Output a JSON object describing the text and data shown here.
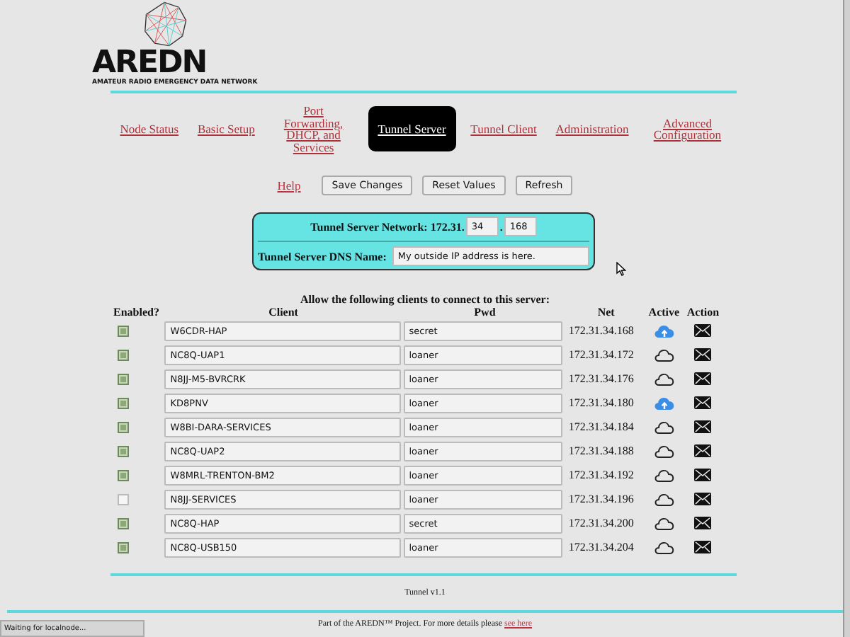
{
  "logo": {
    "wordmark": "AREDN",
    "tagline": "AMATEUR RADIO EMERGENCY DATA NETWORK"
  },
  "nav": [
    {
      "label": "Node Status",
      "selected": false
    },
    {
      "label": "Basic Setup",
      "selected": false
    },
    {
      "label": "Port Forwarding, DHCP, and Services",
      "selected": false
    },
    {
      "label": "Tunnel Server",
      "selected": true
    },
    {
      "label": "Tunnel Client",
      "selected": false
    },
    {
      "label": "Administration",
      "selected": false
    },
    {
      "label": "Advanced Configuration",
      "selected": false
    }
  ],
  "help_link": "Help",
  "buttons": [
    "Save Changes",
    "Reset Values",
    "Refresh"
  ],
  "server": {
    "network_label": "Tunnel Server Network: 172.31.",
    "octet_3": "34",
    "separator": ".",
    "octet_4": "168",
    "dns_label": "Tunnel Server DNS Name:",
    "dns_value": "My outside IP address is here."
  },
  "table": {
    "caption": "Allow the following clients to connect to this server:",
    "columns": [
      "Enabled?",
      "Client",
      "Pwd",
      "Net",
      "Active",
      "Action"
    ],
    "rows": [
      {
        "enabled": true,
        "client": "W6CDR-HAP",
        "pwd": "secret",
        "net": "172.31.34.168",
        "active": true
      },
      {
        "enabled": true,
        "client": "NC8Q-UAP1",
        "pwd": "loaner",
        "net": "172.31.34.172",
        "active": false
      },
      {
        "enabled": true,
        "client": "N8JJ-M5-BVRCRK",
        "pwd": "loaner",
        "net": "172.31.34.176",
        "active": false
      },
      {
        "enabled": true,
        "client": "KD8PNV",
        "pwd": "loaner",
        "net": "172.31.34.180",
        "active": true
      },
      {
        "enabled": true,
        "client": "W8BI-DARA-SERVICES",
        "pwd": "loaner",
        "net": "172.31.34.184",
        "active": false
      },
      {
        "enabled": true,
        "client": "NC8Q-UAP2",
        "pwd": "loaner",
        "net": "172.31.34.188",
        "active": false
      },
      {
        "enabled": true,
        "client": "W8MRL-TRENTON-BM2",
        "pwd": "loaner",
        "net": "172.31.34.192",
        "active": false
      },
      {
        "enabled": false,
        "client": "N8JJ-SERVICES",
        "pwd": "loaner",
        "net": "172.31.34.196",
        "active": false
      },
      {
        "enabled": true,
        "client": "NC8Q-HAP",
        "pwd": "secret",
        "net": "172.31.34.200",
        "active": false
      },
      {
        "enabled": true,
        "client": "NC8Q-USB150",
        "pwd": "loaner",
        "net": "172.31.34.204",
        "active": false
      }
    ]
  },
  "version": "Tunnel v1.1",
  "footer": {
    "text": "Part of the AREDN™ Project. For more details please",
    "link": "see here"
  },
  "status_bar": "Waiting for localnode..."
}
